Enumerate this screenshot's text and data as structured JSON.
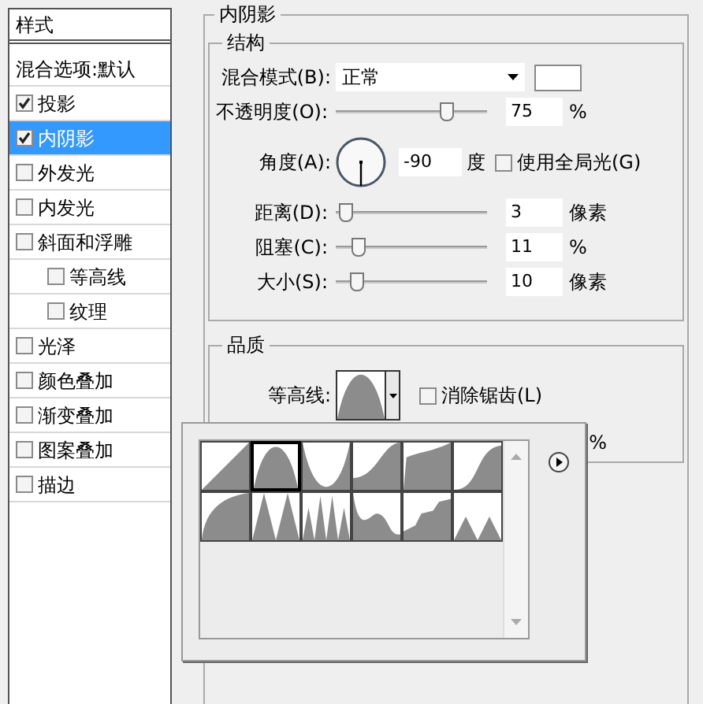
{
  "sidebar": {
    "header": "样式",
    "items": [
      {
        "label": "混合选项:默认",
        "kind": "plain",
        "selected": false
      },
      {
        "label": "投影",
        "kind": "check",
        "checked": true,
        "selected": false
      },
      {
        "label": "内阴影",
        "kind": "check",
        "checked": true,
        "selected": true
      },
      {
        "label": "外发光",
        "kind": "check",
        "checked": false,
        "selected": false
      },
      {
        "label": "内发光",
        "kind": "check",
        "checked": false,
        "selected": false
      },
      {
        "label": "斜面和浮雕",
        "kind": "check",
        "checked": false,
        "selected": false,
        "children": [
          {
            "label": "等高线",
            "kind": "check",
            "checked": false,
            "selected": false
          },
          {
            "label": "纹理",
            "kind": "check",
            "checked": false,
            "selected": false
          }
        ]
      },
      {
        "label": "光泽",
        "kind": "check",
        "checked": false,
        "selected": false
      },
      {
        "label": "颜色叠加",
        "kind": "check",
        "checked": false,
        "selected": false
      },
      {
        "label": "渐变叠加",
        "kind": "check",
        "checked": false,
        "selected": false
      },
      {
        "label": "图案叠加",
        "kind": "check",
        "checked": false,
        "selected": false
      },
      {
        "label": "描边",
        "kind": "check",
        "checked": false,
        "selected": false
      }
    ]
  },
  "panel": {
    "title": "内阴影",
    "structure": {
      "title": "结构",
      "blend_mode": {
        "label": "混合模式(B):",
        "value": "正常"
      },
      "opacity": {
        "label": "不透明度(O):",
        "level": 0.75,
        "value": "75",
        "unit": "%"
      },
      "angle": {
        "label": "角度(A):",
        "value": "-90",
        "unit": "度"
      },
      "global_light": {
        "label": "使用全局光(G)",
        "checked": false
      },
      "distance": {
        "label": "距离(D):",
        "level": 0.02,
        "value": "3",
        "unit": "像素"
      },
      "choke": {
        "label": "阻塞(C):",
        "level": 0.11,
        "value": "11",
        "unit": "%"
      },
      "size": {
        "label": "大小(S):",
        "level": 0.1,
        "value": "10",
        "unit": "像素"
      }
    },
    "quality": {
      "title": "品质",
      "contour_label": "等高线:",
      "anti_alias": {
        "label": "消除锯齿(L)",
        "checked": false
      },
      "hidden_unit": "%"
    }
  },
  "contour_picker": {
    "contours": [
      {
        "kind": "linear",
        "selected": false
      },
      {
        "kind": "cone",
        "selected": true
      },
      {
        "kind": "cone-inverted",
        "selected": false
      },
      {
        "kind": "cove-deep",
        "selected": false
      },
      {
        "kind": "cove-shallow",
        "selected": false
      },
      {
        "kind": "gaussian",
        "selected": false
      },
      {
        "kind": "half-round",
        "selected": false
      },
      {
        "kind": "ring",
        "selected": false
      },
      {
        "kind": "ring-double",
        "selected": false
      },
      {
        "kind": "rolling-slope",
        "selected": false
      },
      {
        "kind": "rounded-steps",
        "selected": false
      },
      {
        "kind": "sawtooth",
        "selected": false
      }
    ]
  }
}
